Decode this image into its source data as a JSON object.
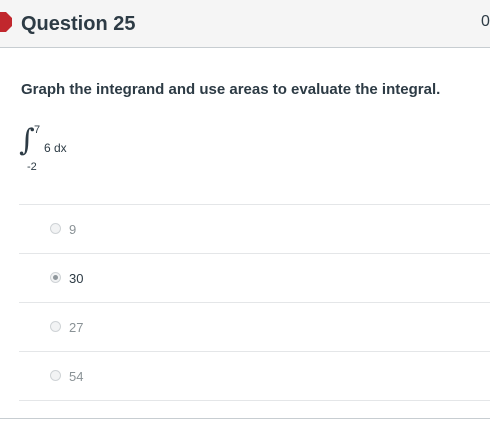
{
  "question": {
    "title": "Question 25",
    "points_fragment": "0",
    "prompt": "Graph the integrand and use areas to evaluate the integral.",
    "flag_color": "#c1272d"
  },
  "integral": {
    "sign": "∫",
    "upper": "7",
    "lower": "-2",
    "expression": "6 dx"
  },
  "answers": [
    {
      "label": "9",
      "selected": false
    },
    {
      "label": "30",
      "selected": true
    },
    {
      "label": "27",
      "selected": false
    },
    {
      "label": "54",
      "selected": false
    }
  ]
}
